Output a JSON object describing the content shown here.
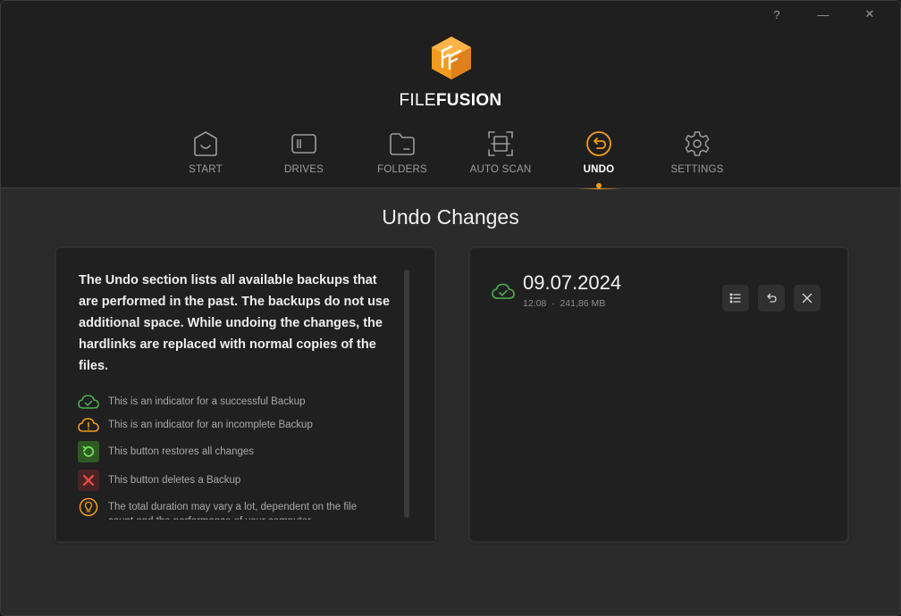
{
  "window": {
    "help_label": "?",
    "minimize_label": "—",
    "close_label": "✕"
  },
  "brand": {
    "part1": "FILE",
    "part2": "FUSION",
    "accent_color": "#f39c1f"
  },
  "nav": {
    "items": [
      {
        "label": "START",
        "icon": "home-icon",
        "active": false
      },
      {
        "label": "DRIVES",
        "icon": "drive-icon",
        "active": false
      },
      {
        "label": "FOLDERS",
        "icon": "folder-icon",
        "active": false
      },
      {
        "label": "AUTO SCAN",
        "icon": "scan-icon",
        "active": false
      },
      {
        "label": "UNDO",
        "icon": "undo-icon",
        "active": true
      },
      {
        "label": "SETTINGS",
        "icon": "gear-icon",
        "active": false
      }
    ]
  },
  "page": {
    "title": "Undo Changes"
  },
  "info": {
    "description": "The Undo section lists all available backups that are performed in the past. The backups do not use additional space. While undoing the changes, the hardlinks are replaced with normal copies of the files.",
    "legend": [
      {
        "icon": "cloud-check-icon",
        "text": "This is an indicator for a successful Backup"
      },
      {
        "icon": "cloud-warning-icon",
        "text": "This is an indicator for an incomplete Backup"
      },
      {
        "icon": "restore-icon",
        "text": "This button restores all changes"
      },
      {
        "icon": "delete-icon",
        "text": "This button deletes a Backup"
      },
      {
        "icon": "lightbulb-icon",
        "text": "The total duration may vary a lot, dependent on the file count and the performance of your computer."
      }
    ]
  },
  "backups": [
    {
      "date": "09.07.2024",
      "time": "12:08",
      "size": "241,86 MB",
      "status": "success"
    }
  ]
}
